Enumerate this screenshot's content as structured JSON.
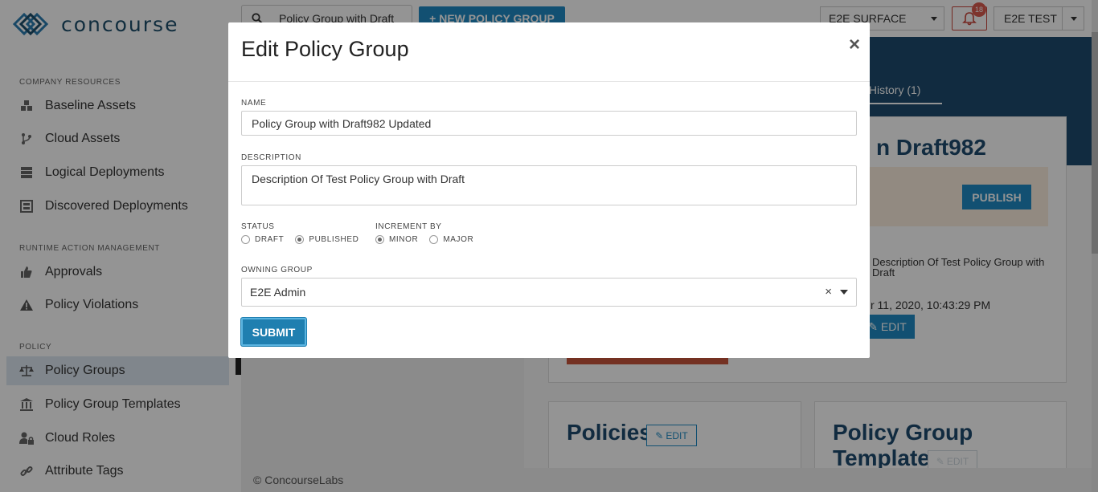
{
  "app": {
    "brand": "concourse"
  },
  "sidebar": {
    "sections": [
      {
        "title": "COMPANY RESOURCES"
      },
      {
        "title": "RUNTIME ACTION MANAGEMENT"
      },
      {
        "title": "POLICY"
      }
    ],
    "items": [
      {
        "label": "Baseline Assets",
        "icon": "cubes-icon"
      },
      {
        "label": "Cloud Assets",
        "icon": "branch-icon"
      },
      {
        "label": "Logical Deployments",
        "icon": "server-icon"
      },
      {
        "label": "Discovered Deployments",
        "icon": "scan-icon"
      },
      {
        "label": "Approvals",
        "icon": "thumbs-up-icon"
      },
      {
        "label": "Policy Violations",
        "icon": "warning-icon"
      },
      {
        "label": "Policy Groups",
        "icon": "balance-scale-icon",
        "active": true
      },
      {
        "label": "Policy Group Templates",
        "icon": "institution-icon"
      },
      {
        "label": "Cloud Roles",
        "icon": "user-lock-icon"
      },
      {
        "label": "Attribute Tags",
        "icon": "link-icon"
      }
    ]
  },
  "header": {
    "search_value": "Policy Group with Draft",
    "new_button": "+ NEW POLICY GROUP",
    "surface": "E2E SURFACE",
    "notification_count": "18",
    "user": "E2E TEST"
  },
  "background_page": {
    "audit_tab": "it History (1)",
    "title_fragment": "n Draft982",
    "publish_button": "PUBLISH",
    "description_fragment": "Description Of Test Policy Group with Draft",
    "date_fragment": "r 11, 2020, 10:43:29 PM",
    "edit_button": "EDIT",
    "policies_title": "Policies",
    "policies_edit": "EDIT",
    "template_title_line1": "Policy Group",
    "template_title_line2": "Template",
    "template_edit": "EDIT",
    "footer": "© ConcourseLabs"
  },
  "modal": {
    "title": "Edit Policy Group",
    "close": "×",
    "name_label": "NAME",
    "name_value": "Policy Group with Draft982 Updated",
    "description_label": "DESCRIPTION",
    "description_value": "Description Of Test Policy Group with Draft",
    "status_label": "STATUS",
    "status_options": [
      {
        "label": "DRAFT",
        "selected": false
      },
      {
        "label": "PUBLISHED",
        "selected": true
      }
    ],
    "increment_label": "INCREMENT BY",
    "increment_options": [
      {
        "label": "MINOR",
        "selected": true
      },
      {
        "label": "MAJOR",
        "selected": false
      }
    ],
    "owning_label": "OWNING GROUP",
    "owning_value": "E2E Admin",
    "clear": "×",
    "submit": "SUBMIT"
  },
  "colors": {
    "accent": "#1f8bc4",
    "hero": "#1e4b6e",
    "danger": "#c8453b"
  }
}
